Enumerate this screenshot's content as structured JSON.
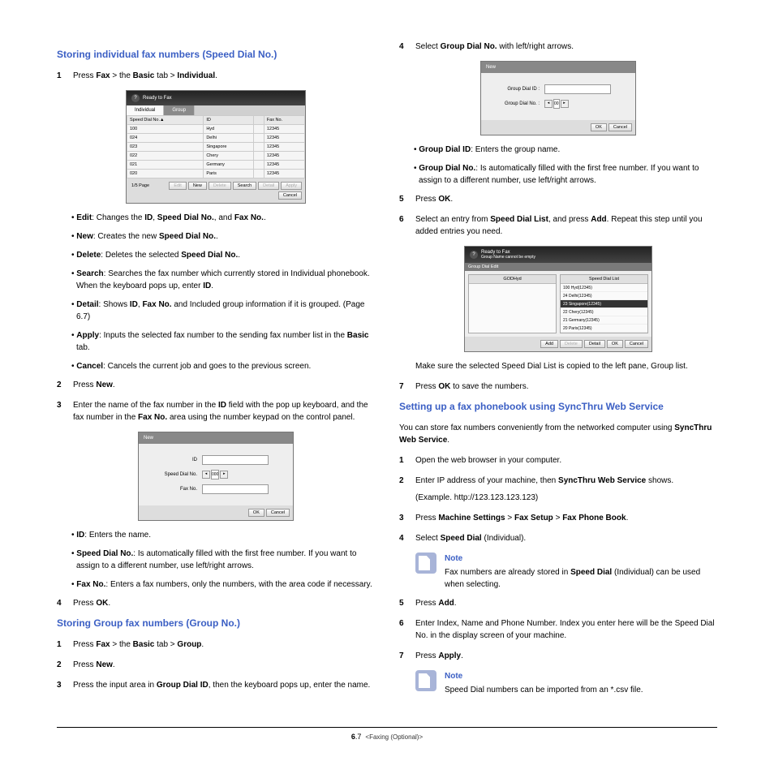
{
  "left": {
    "h1": "Storing individual fax numbers (Speed Dial No.)",
    "s1": {
      "pre": "Press ",
      "b1": "Fax",
      "mid1": " > the ",
      "b2": "Basic",
      "mid2": " tab > ",
      "b3": "Individual",
      "end": "."
    },
    "ss1": {
      "title": "Ready to Fax",
      "tab1": "Individual",
      "tab2": "Group",
      "cols": {
        "c1": "Speed Dial No.▲",
        "c2": "ID",
        "c3": "",
        "c4": "Fax No."
      },
      "rows": [
        {
          "n": "100",
          "id": "Hyd",
          "f": "12345"
        },
        {
          "n": "024",
          "id": "Delhi",
          "f": "12345"
        },
        {
          "n": "023",
          "id": "Singapore",
          "f": "12345"
        },
        {
          "n": "022",
          "id": "Chery",
          "f": "12345"
        },
        {
          "n": "021",
          "id": "Germany",
          "f": "12345"
        },
        {
          "n": "020",
          "id": "Paris",
          "f": "12345"
        }
      ],
      "page": "1/5 Page",
      "btns": {
        "edit": "Edit",
        "new": "New",
        "del": "Delete",
        "search": "Search",
        "detail": "Detail",
        "apply": "Apply",
        "cancel": "Cancel"
      }
    },
    "bul": {
      "b1p": "Edit",
      "b1": ": Changes the ",
      "b1a": "ID",
      "b1b": ", ",
      "b1c": "Speed Dial No.",
      "b1d": ", and ",
      "b1e": "Fax No.",
      "b1f": ".",
      "b2p": "New",
      "b2": ": Creates the new ",
      "b2a": "Speed Dial No.",
      "b2b": ".",
      "b3p": "Delete",
      "b3": ": Deletes the selected ",
      "b3a": "Speed Dial No.",
      "b3b": ".",
      "b4p": "Search",
      "b4": ": Searches the fax number which currently stored in Individual phonebook. When the keyboard pops up, enter ",
      "b4a": "ID",
      "b4b": ".",
      "b5p": "Detail",
      "b5": ": Shows ",
      "b5a": "ID",
      "b5b": ", ",
      "b5c": "Fax No.",
      "b5d": " and Included group information if it is grouped. (Page 6.7)",
      "b6p": "Apply",
      "b6": ": Inputs the selected fax number to the sending fax number list in the ",
      "b6a": "Basic",
      "b6b": " tab.",
      "b7p": "Cancel",
      "b7": ": Cancels the current job and goes to the previous screen."
    },
    "s2": {
      "pre": "Press ",
      "b": "New",
      "end": "."
    },
    "s3": {
      "t1": "Enter the name of the fax number in the ",
      "b1": "ID",
      "t2": " field with the pop up keyboard, and the fax number in the ",
      "b2": "Fax No.",
      "t3": " area using the number keypad on the control panel."
    },
    "ss2": {
      "title": "New",
      "f1": "ID",
      "f2": "Speed Dial No.",
      "f2v": "000",
      "f3": "Fax No.",
      "ok": "OK",
      "cancel": "Cancel"
    },
    "bul2": {
      "b1p": "ID",
      "b1": ": Enters the name.",
      "b2p": "Speed Dial No.",
      "b2": ": Is automatically filled with the first free number. If you want to assign to a different number, use left/right arrows.",
      "b3p": "Fax No.",
      "b3": ": Enters a fax numbers, only the numbers, with the area code if necessary."
    },
    "s4": {
      "pre": "Press ",
      "b": "OK",
      "end": "."
    },
    "h2": "Storing Group fax numbers (Group No.)",
    "g_s1": {
      "pre": "Press ",
      "b1": "Fax",
      "m1": " > the ",
      "b2": "Basic",
      "m2": " tab > ",
      "b3": "Group",
      "end": "."
    },
    "g_s2": {
      "pre": "Press ",
      "b": "New",
      "end": "."
    },
    "g_s3": {
      "t1": "Press the input area in ",
      "b1": "Group Dial ID",
      "t2": ", then the keyboard pops up, enter the name."
    }
  },
  "right": {
    "s4": {
      "pre": "Select ",
      "b": "Group Dial No.",
      "end": " with left/right arrows."
    },
    "ss3": {
      "title": "New",
      "f1": "Group Dial ID :",
      "f2": "Group Dial No. :",
      "v2": "00",
      "ok": "OK",
      "cancel": "Cancel"
    },
    "bul3": {
      "b1p": "Group Dial ID",
      "b1": ": Enters the group name.",
      "b2p": "Group Dial No.",
      "b2": ": Is automatically filled with the first free number. If you want to assign to a different number, use left/right arrows."
    },
    "s5": {
      "pre": "Press ",
      "b": "OK",
      "end": "."
    },
    "s6": {
      "t1": "Select an entry from ",
      "b1": "Speed Dial List",
      "t2": ", and press ",
      "b2": "Add",
      "t3": ". Repeat this step until you added entries you need."
    },
    "ss4": {
      "title": "Ready to Fax",
      "sub": "Group Name cannot be empty",
      "band": "Group Dial Edit",
      "left_hd": "GODHyd",
      "right_hd": "Speed Dial List",
      "rows": [
        {
          "n": "100",
          "t": "Hyd(12345)"
        },
        {
          "n": "24",
          "t": "Delhi(12345)"
        },
        {
          "n": "23",
          "t": "Singapore(12345)"
        },
        {
          "n": "22",
          "t": "Chery(12345)"
        },
        {
          "n": "21",
          "t": "Germany(12345)"
        },
        {
          "n": "20",
          "t": "Paris(12345)"
        }
      ],
      "btns": {
        "add": "Add",
        "del": "Delete",
        "detail": "Detail",
        "ok": "OK",
        "cancel": "Cancel"
      }
    },
    "s6b": "Make sure the selected Speed Dial List is copied to the left pane, Group list.",
    "s7": {
      "pre": "Press ",
      "b": "OK",
      "end": " to save the numbers."
    },
    "h3": "Setting up a fax phonebook using SyncThru Web Service",
    "intro": {
      "t1": "You can store fax numbers conveniently from the networked computer using ",
      "b": "SyncThru Web Service",
      "t2": "."
    },
    "w_s1": "Open the web browser in your computer.",
    "w_s2": {
      "t1": "Enter IP address of your machine, then ",
      "b": "SyncThru Web Service",
      "t2": " shows."
    },
    "w_s2ex": "(Example. http://123.123.123.123)",
    "w_s3": {
      "pre": "Press ",
      "b1": "Machine Settings",
      "m1": " > ",
      "b2": "Fax Setup",
      "m2": " > ",
      "b3": "Fax Phone Book",
      "end": "."
    },
    "w_s4": {
      "pre": "Select ",
      "b": "Speed Dial",
      "end": " (Individual)."
    },
    "note1": {
      "title": "Note",
      "t1": "Fax numbers are already stored in ",
      "b": "Speed Dial",
      "t2": " (Individual) can be used when selecting."
    },
    "w_s5": {
      "pre": "Press ",
      "b": "Add",
      "end": "."
    },
    "w_s6": "Enter Index, Name and Phone Number. Index you enter here will be the Speed Dial No. in the display screen of your machine.",
    "w_s7": {
      "pre": "Press ",
      "b": "Apply",
      "end": "."
    },
    "note2": {
      "title": "Note",
      "t": "Speed Dial numbers can be imported from an *.csv file."
    }
  },
  "footer": {
    "page": "6",
    "sub": ".7",
    "section": "<Faxing (Optional)>"
  }
}
